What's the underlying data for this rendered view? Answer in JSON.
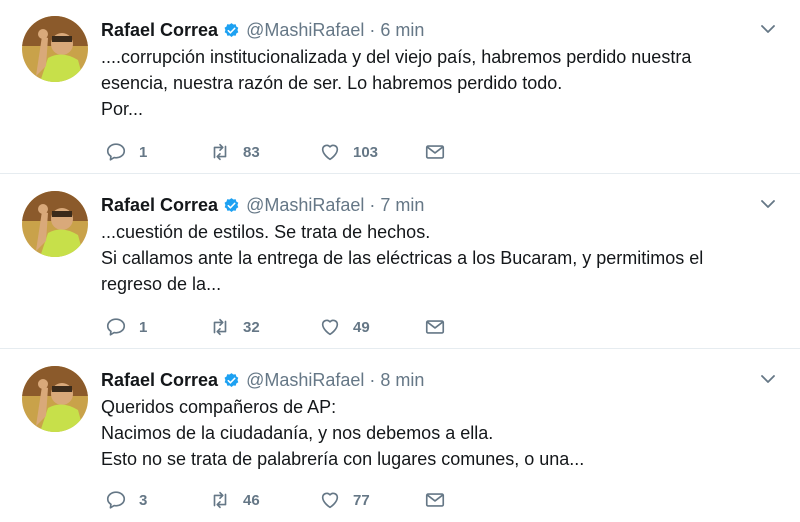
{
  "tweets": [
    {
      "name": "Rafael Correa",
      "handle": "@MashiRafael",
      "time": "6 min",
      "lines": [
        "....corrupción institucionalizada y del viejo país, habremos perdido nuestra",
        "esencia, nuestra razón de ser. Lo habremos perdido todo.",
        "Por..."
      ],
      "replies": "1",
      "retweets": "83",
      "likes": "103"
    },
    {
      "name": "Rafael Correa",
      "handle": "@MashiRafael",
      "time": "7 min",
      "lines": [
        "...cuestión de estilos. Se trata de hechos.",
        "Si callamos ante la entrega de las eléctricas a los Bucaram, y permitimos el",
        "regreso de la..."
      ],
      "replies": "1",
      "retweets": "32",
      "likes": "49"
    },
    {
      "name": "Rafael Correa",
      "handle": "@MashiRafael",
      "time": "8 min",
      "lines": [
        "Queridos compañeros de AP:",
        "Nacimos de la ciudadanía, y nos debemos a ella.",
        "Esto no se trata de palabrería con lugares comunes, o una..."
      ],
      "replies": "3",
      "retweets": "46",
      "likes": "77"
    }
  ],
  "separator": "·",
  "icons": {
    "verified": "verified-badge-icon",
    "caret": "chevron-down-icon",
    "reply": "reply-icon",
    "retweet": "retweet-icon",
    "like": "heart-icon",
    "dm": "envelope-icon"
  },
  "colors": {
    "text": "#14171a",
    "muted": "#657786",
    "verified": "#1da1f2",
    "divider": "#e6ecf0"
  }
}
